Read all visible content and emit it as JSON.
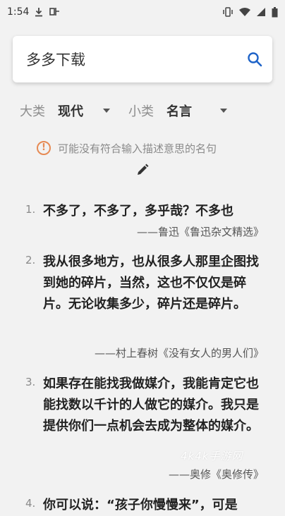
{
  "status_bar": {
    "time": "1:54"
  },
  "search": {
    "query": "多多下载"
  },
  "filters": {
    "category_label": "大类",
    "category_value": "现代",
    "subcategory_label": "小类",
    "subcategory_value": "名言"
  },
  "notice": {
    "text": "可能没有符合输入描述意思的名句"
  },
  "quotes": [
    {
      "num": "1.",
      "text": "不多了，不多了，多乎哉？不多也",
      "source": "——鲁迅《鲁迅杂文精选》"
    },
    {
      "num": "2.",
      "text": "我从很多地方，也从很多人那里企图找到她的碎片，当然，这也不仅仅是碎片。无论收集多少，碎片还是碎片。",
      "source": "——村上春树《没有女人的男人们》"
    },
    {
      "num": "3.",
      "text": "如果存在能找我做媒介，我能肯定它也能找数以千计的人做它的媒介。我只是提供你们一点机会去成为整体的媒介。",
      "source": "——奥修《奥修传》"
    },
    {
      "num": "4.",
      "text": "你可以说：“孩子你慢慢来”，可是"
    }
  ],
  "watermark": "4k4k手游网",
  "colors": {
    "accent": "#1e63c8",
    "warning": "#e68a54"
  }
}
